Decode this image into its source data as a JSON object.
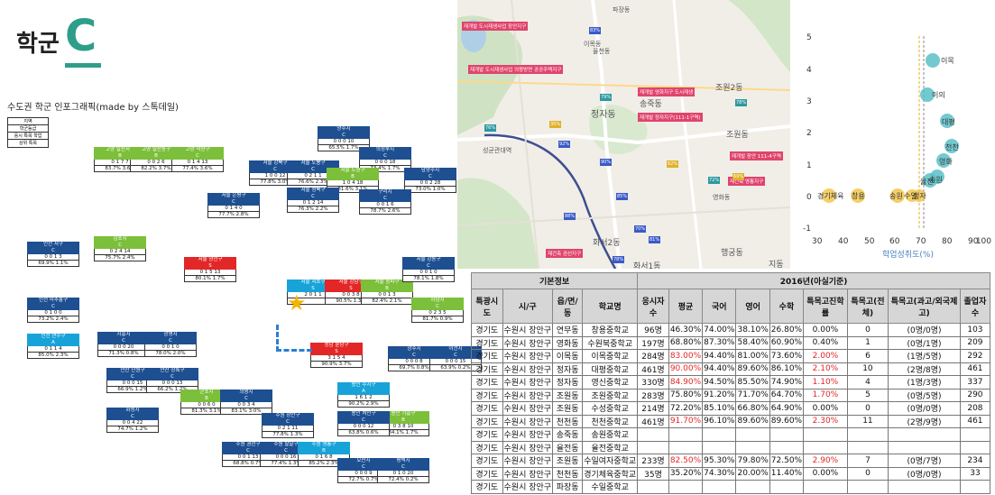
{
  "header": {
    "title": "학군",
    "grade": "C"
  },
  "infographic": {
    "subtitle": "수도권 학군 인포그래픽(made by 스톡데일)",
    "legend": [
      "지역",
      "학군등급",
      "응시 특목 학업",
      "상위 특목"
    ],
    "tiles": [
      {
        "name": "양주시",
        "grade": "C",
        "r1": "0 0 0 10",
        "r2": "65.5% 1.7%",
        "color": "blue"
      },
      {
        "name": "의정부시",
        "grade": "C",
        "r1": "0 0 0 18",
        "r2": "73.4% 1.7%",
        "color": "blue"
      },
      {
        "name": "고양 일산서구",
        "grade": "B",
        "r1": "0 1 7 7",
        "r2": "83.7% 3.6%",
        "color": "green"
      },
      {
        "name": "고양 일산동구",
        "grade": "B",
        "r1": "0 0 2 6",
        "r2": "82.2% 3.7%",
        "color": "green"
      },
      {
        "name": "고양 덕양구",
        "grade": "C",
        "r1": "0 1 4 13",
        "r2": "77.4% 3.6%",
        "color": "green"
      },
      {
        "name": "서울 강북구",
        "grade": "C",
        "r1": "1 0 0 12",
        "r2": "77.8% 3.0%",
        "color": "blue"
      },
      {
        "name": "서울 도봉구",
        "grade": "C",
        "r1": "0 2 1 1",
        "r2": "76.6% 2.3%",
        "color": "blue"
      },
      {
        "name": "남양주시",
        "grade": "C",
        "r1": "0 0 2 28",
        "r2": "73.0% 1.0%",
        "color": "blue"
      },
      {
        "name": "서울 노원구",
        "grade": "B",
        "r1": "1 0 4 18",
        "r2": "81.6% 3.1%",
        "color": "green"
      },
      {
        "name": "서울 은평구",
        "grade": "C",
        "r1": "0 1 4 0",
        "r2": "77.7% 2.8%",
        "color": "blue"
      },
      {
        "name": "서울 성북구",
        "grade": "C",
        "r1": "0 1 2 14",
        "r2": "76.3% 2.2%",
        "color": "blue"
      },
      {
        "name": "구리시",
        "grade": "C",
        "r1": "0 0 1 6",
        "r2": "78.7% 2.6%",
        "color": "blue"
      },
      {
        "name": "인천 서구",
        "grade": "C",
        "r1": "0 0 1 3",
        "r2": "69.9% 1.1%",
        "color": "blue"
      },
      {
        "name": "김포시",
        "grade": "C",
        "r1": "0 2 4 14",
        "r2": "75.7% 2.4%",
        "color": "green"
      },
      {
        "name": "서울 양천구",
        "grade": "S",
        "r1": "0 1 5 13",
        "r2": "80.1% 1.7%",
        "color": "red"
      },
      {
        "name": "서울 서초구",
        "grade": "S",
        "r1": "2 0 1 1",
        "r2": "",
        "color": "cyan"
      },
      {
        "name": "서울 강남구",
        "grade": "S",
        "r1": "0 0 3 8",
        "r2": "90.5% 1.3%",
        "color": "red"
      },
      {
        "name": "서울 송파구",
        "grade": "B",
        "r1": "0 0 1 3",
        "r2": "82.4% 2.1%",
        "color": "green"
      },
      {
        "name": "서울 강동구",
        "grade": "C",
        "r1": "0 0 1 0",
        "r2": "78.1% 1.8%",
        "color": "blue"
      },
      {
        "name": "인천 미추홀구",
        "grade": "C",
        "r1": "0 1 0 0",
        "r2": "73.2% 2.4%",
        "color": "blue"
      },
      {
        "name": "인천 연수구",
        "grade": "A",
        "r1": "0 1 1 4",
        "r2": "85.0% 2.3%",
        "color": "cyan"
      },
      {
        "name": "시흥시",
        "grade": "C",
        "r1": "0 0 0 20",
        "r2": "71.3% 0.8%",
        "color": "blue"
      },
      {
        "name": "광명시",
        "grade": "C",
        "r1": "0 0 1 0",
        "r2": "78.0% 2.0%",
        "color": "blue"
      },
      {
        "name": "성남 분당구",
        "grade": "S",
        "r1": "3 1 5 4",
        "r2": "90.9% 3.7%",
        "color": "red"
      },
      {
        "name": "하남시",
        "grade": "C",
        "r1": "0 2 3 5",
        "r2": "81.7% 0.9%",
        "color": "green"
      },
      {
        "name": "광주시",
        "grade": "C",
        "r1": "0 0 0 8",
        "r2": "69.7% 0.8%",
        "color": "blue"
      },
      {
        "name": "이천시",
        "grade": "C",
        "r1": "0 0 0 15",
        "r2": "63.9% 0.2%",
        "color": "blue"
      },
      {
        "name": "안산 단원구",
        "grade": "C",
        "r1": "0 0 0 15",
        "r2": "66.9% 1.2%",
        "color": "blue"
      },
      {
        "name": "안산 상록구",
        "grade": "C",
        "r1": "0 0 0 13",
        "r2": "66.2% 1.2%",
        "color": "blue"
      },
      {
        "name": "군포시",
        "grade": "B",
        "r1": "0 0 6 0",
        "r2": "81.3% 3.1%",
        "color": "green"
      },
      {
        "name": "의왕시",
        "grade": "C",
        "r1": "0 0 3 4",
        "r2": "83.1% 3.0%",
        "color": "blue"
      },
      {
        "name": "수원 장안구",
        "grade": "C",
        "r1": "0 2 1 11",
        "r2": "77.8% 1.3%",
        "color": "blue"
      },
      {
        "name": "용인 수지구",
        "grade": "A",
        "r1": "1 6 1 2",
        "r2": "90.2% 2.9%",
        "color": "cyan"
      },
      {
        "name": "용인 기흥구",
        "grade": "B",
        "r1": "0 3 8 10",
        "r2": "84.1% 1.7%",
        "color": "green"
      },
      {
        "name": "용인 처인구",
        "grade": "C",
        "r1": "0 0 0 12",
        "r2": "63.8% 0.6%",
        "color": "blue"
      },
      {
        "name": "화성시",
        "grade": "C",
        "r1": "0 0 4 22",
        "r2": "74.7% 1.2%",
        "color": "blue"
      },
      {
        "name": "수원 권선구",
        "grade": "C",
        "r1": "0 0 1 13",
        "r2": "68.8% 0.7%",
        "color": "blue"
      },
      {
        "name": "수원 팔달구",
        "grade": "C",
        "r1": "0 0 0 16",
        "r2": "77.4% 1.3%",
        "color": "blue"
      },
      {
        "name": "수원 영통구",
        "grade": "B",
        "r1": "0 1 6 8",
        "r2": "85.2% 2.3%",
        "color": "cyan"
      },
      {
        "name": "오산시",
        "grade": "C",
        "r1": "0 0 0 9",
        "r2": "72.7% 0.7%",
        "color": "blue"
      },
      {
        "name": "평택시",
        "grade": "C",
        "r1": "0 1 0 20",
        "r2": "72.4% 0.2%",
        "color": "blue"
      }
    ]
  },
  "map": {
    "labels": [
      "파장동",
      "이목동",
      "정자동",
      "조원동",
      "성균관대역",
      "영화동",
      "화서2동",
      "화서1동",
      "지동",
      "행궁동",
      "송죽동",
      "조원2동",
      "율천동"
    ],
    "pink_tags": [
      "재개발 도시재생사업 장안지구",
      "재개발 도시재생사업 의왕방면 공공주택지구",
      "재개발 정자지구(111-1구역)",
      "재개발 영화지구 도시재생",
      "재개발 장안 111-4구역",
      "재건축 권선지구",
      "재건축 영통지구"
    ],
    "pins": [
      "83%",
      "79%",
      "76%",
      "35%",
      "92%",
      "90%",
      "62%",
      "72%",
      "69%",
      "85%",
      "88%",
      "70%",
      "81%",
      "78%",
      "78%"
    ]
  },
  "scatter": {
    "xlabel": "학업성취도(%)",
    "xticks": [
      "30",
      "40",
      "50",
      "60",
      "70",
      "80",
      "90",
      "100"
    ],
    "yticks": [
      "5",
      "4",
      "3",
      "2",
      "1",
      "0",
      "-1"
    ],
    "points_labels": [
      "이목",
      "이의",
      "대평",
      "천천",
      "영화",
      "송원",
      "율전",
      "정자",
      "경기체육",
      "창용",
      "송원",
      "수일"
    ]
  },
  "table": {
    "group_headers": [
      "기본정보",
      "2016년(아실기준)"
    ],
    "columns": [
      "특광시도",
      "시/구",
      "읍/면/동",
      "학교명",
      "응시자수",
      "평균",
      "국어",
      "영어",
      "수학",
      "특목고진학률",
      "특목고(전체)",
      "특목고(과고/외국제고)",
      "졸업자수"
    ],
    "rows": [
      [
        "경기도",
        "수원시 장안구",
        "연무동",
        "창용중학교",
        "96명",
        "46.30%",
        "74.00%",
        "38.10%",
        "26.80%",
        "0.00%",
        "0",
        "(0명/0명)",
        "103"
      ],
      [
        "경기도",
        "수원시 장안구",
        "영화동",
        "수원북중학교",
        "197명",
        "68.80%",
        "87.30%",
        "58.40%",
        "60.90%",
        "0.40%",
        "1",
        "(0명/1명)",
        "209"
      ],
      [
        "경기도",
        "수원시 장안구",
        "이목동",
        "이목중학교",
        "284명",
        "83.00%",
        "94.40%",
        "81.00%",
        "73.60%",
        "2.00%",
        "6",
        "(1명/5명)",
        "292"
      ],
      [
        "경기도",
        "수원시 장안구",
        "정자동",
        "대평중학교",
        "461명",
        "90.00%",
        "94.40%",
        "89.60%",
        "86.10%",
        "2.10%",
        "10",
        "(2명/8명)",
        "461"
      ],
      [
        "경기도",
        "수원시 장안구",
        "정자동",
        "영신중학교",
        "330명",
        "84.90%",
        "94.50%",
        "85.50%",
        "74.90%",
        "1.10%",
        "4",
        "(1명/3명)",
        "337"
      ],
      [
        "경기도",
        "수원시 장안구",
        "조원동",
        "조원중학교",
        "283명",
        "75.80%",
        "91.20%",
        "71.70%",
        "64.70%",
        "1.70%",
        "5",
        "(0명/5명)",
        "290"
      ],
      [
        "경기도",
        "수원시 장안구",
        "조원동",
        "수성중학교",
        "214명",
        "72.20%",
        "85.10%",
        "66.80%",
        "64.90%",
        "0.00%",
        "0",
        "(0명/0명)",
        "208"
      ],
      [
        "경기도",
        "수원시 장안구",
        "천천동",
        "천천중학교",
        "461명",
        "91.70%",
        "96.10%",
        "89.60%",
        "89.60%",
        "2.30%",
        "11",
        "(2명/9명)",
        "461"
      ],
      [
        "경기도",
        "수원시 장안구",
        "송죽동",
        "송원중학교",
        "",
        "",
        "",
        "",
        "",
        "",
        "",
        "",
        ""
      ],
      [
        "경기도",
        "수원시 장안구",
        "율전동",
        "율전중학교",
        "",
        "",
        "",
        "",
        "",
        "",
        "",
        "",
        ""
      ],
      [
        "경기도",
        "수원시 장안구",
        "조원동",
        "수일여자중학교",
        "233명",
        "82.50%",
        "95.30%",
        "79.80%",
        "72.50%",
        "2.90%",
        "7",
        "(0명/7명)",
        "234"
      ],
      [
        "경기도",
        "수원시 장안구",
        "천천동",
        "경기체육중학교",
        "35명",
        "35.20%",
        "74.30%",
        "20.00%",
        "11.40%",
        "0.00%",
        "0",
        "(0명/0명)",
        "33"
      ],
      [
        "경기도",
        "수원시 장안구",
        "파장동",
        "수일중학교",
        "",
        "",
        "",
        "",
        "",
        "",
        "",
        "",
        ""
      ]
    ],
    "red_cells": [
      [
        2,
        5
      ],
      [
        2,
        9
      ],
      [
        3,
        5
      ],
      [
        3,
        9
      ],
      [
        4,
        5
      ],
      [
        4,
        9
      ],
      [
        5,
        9
      ],
      [
        7,
        5
      ],
      [
        7,
        9
      ],
      [
        10,
        5
      ],
      [
        10,
        9
      ]
    ]
  }
}
